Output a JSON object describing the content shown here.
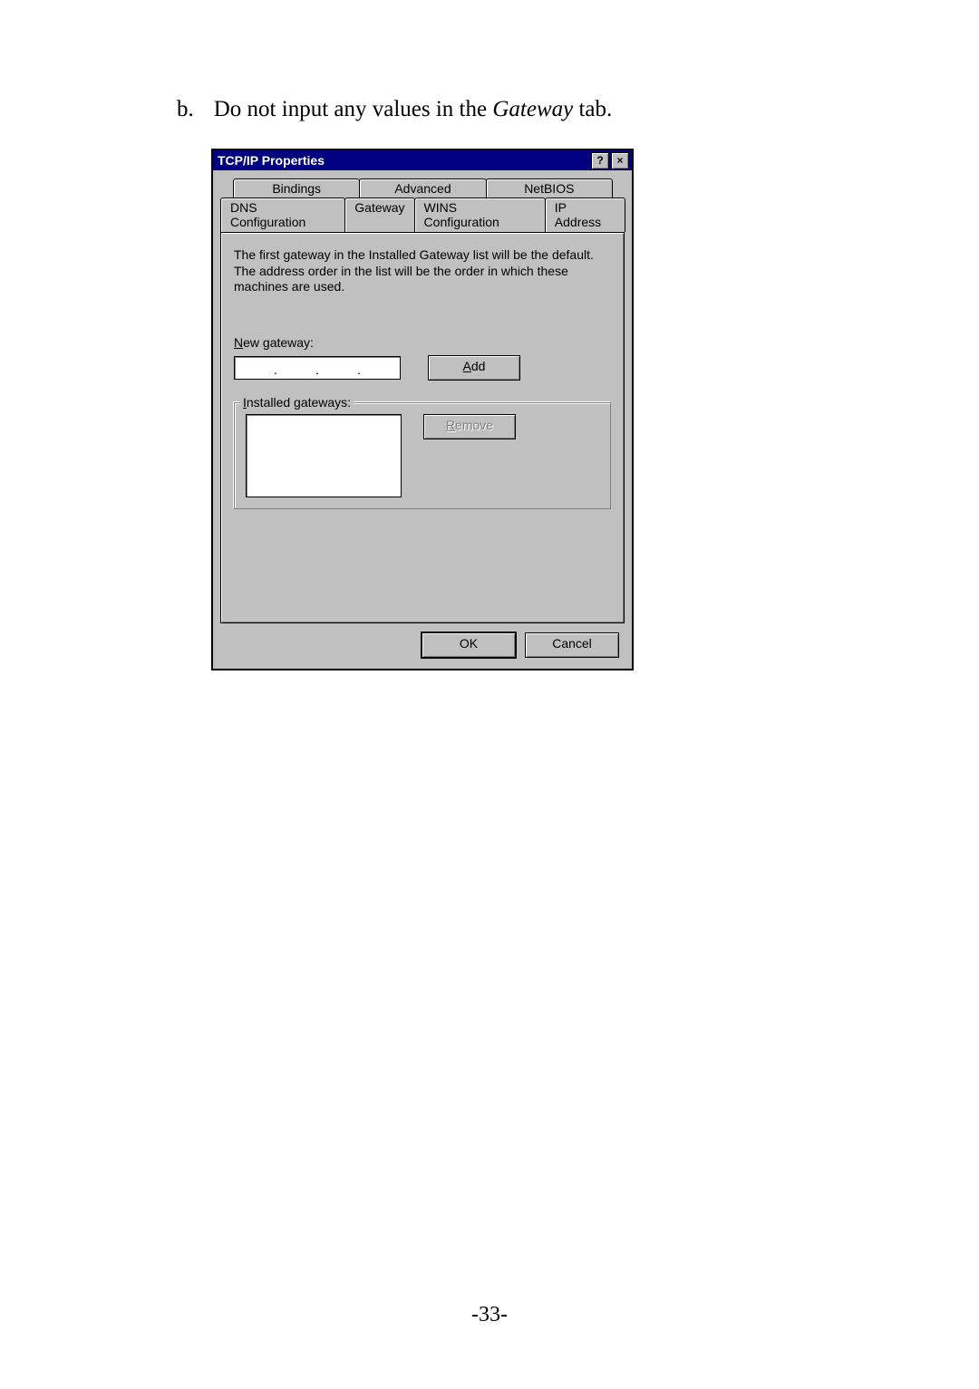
{
  "instruction": {
    "marker": "b.",
    "pre": "Do not input any values in the ",
    "italic": "Gateway",
    "post": " tab."
  },
  "dialog": {
    "title": "TCP/IP Properties",
    "tabs_back": [
      "Bindings",
      "Advanced",
      "NetBIOS"
    ],
    "tabs_front": [
      "DNS Configuration",
      "Gateway",
      "WINS Configuration",
      "IP Address"
    ],
    "active_tab": "Gateway",
    "description": "The first gateway in the Installed Gateway list will be the default. The address order in the list will be the order in which these machines are used.",
    "new_gateway_label_u": "N",
    "new_gateway_label_rest": "ew gateway:",
    "add_label_u": "A",
    "add_label_rest": "dd",
    "installed_label_u": "I",
    "installed_label_rest": "nstalled gateways:",
    "remove_label_u": "R",
    "remove_label_rest": "emove",
    "ok_label": "OK",
    "cancel_label": "Cancel"
  },
  "page_number": "-33-"
}
